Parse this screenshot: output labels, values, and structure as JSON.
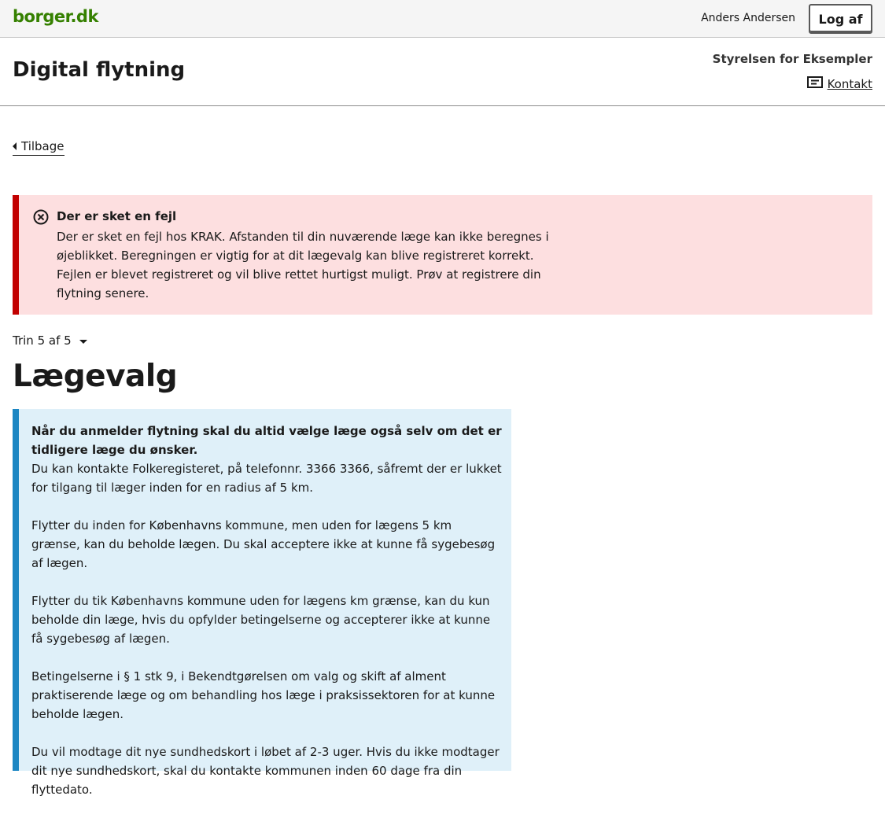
{
  "topbar": {
    "logo": "borger.dk",
    "username": "Anders Andersen",
    "logout_label": "Log af"
  },
  "header": {
    "title": "Digital flytning",
    "authority": "Styrelsen for Eksempler",
    "contact_label": "Kontakt"
  },
  "nav": {
    "back_label": "Tilbage"
  },
  "error": {
    "heading": "Der er sket en fejl",
    "text": "Der er sket en fejl hos KRAK. Afstanden til din nuværende læge kan ikke beregnes i øjeblikket. Beregningen er vigtig for at dit lægevalg kan blive registreret korrekt. Fejlen er blevet registreret og vil blive rettet hurtigst muligt. Prøv at registrere din flytning senere."
  },
  "step": {
    "label": "Trin 5 af 5"
  },
  "page": {
    "title": "Lægevalg"
  },
  "info": {
    "lead": "Når du anmelder flytning skal du altid vælge læge også selv om det er tidligere læge du ønsker.",
    "p1": "Du kan kontakte Folkeregisteret, på telefonnr. 3366 3366, såfremt der er lukket for tilgang til læger inden for en radius af 5 km.",
    "p2": "Flytter du inden for Københavns kommune, men uden for lægens 5 km grænse, kan du beholde lægen. Du skal acceptere ikke at kunne få sygebesøg af lægen.",
    "p3": "Flytter du tik Københavns kommune uden for lægens km grænse, kan du kun beholde din læge, hvis du opfylder betingelserne og accepterer ikke at kunne få sygebesøg af lægen.",
    "p4": "Betingelserne i § 1 stk 9, i Bekendtgørelsen om valg og skift af alment praktiserende læge og om behandling hos læge i praksissektoren for at kunne beholde lægen.",
    "p5": "Du vil modtage dit nye sundhedskort i løbet af 2-3 uger. Hvis du ikke modtager dit nye sundhedskort, skal du kontakte kommunen inden 60 dage fra din flyttedato."
  },
  "colors": {
    "brand_green": "#358000",
    "error_bg": "#fddfe0",
    "error_border": "#c20000",
    "info_bg": "#dff0f9",
    "info_border": "#1b86c3"
  },
  "icons": {
    "error": "close-circle-icon",
    "contact": "message-icon",
    "back": "caret-left-icon",
    "step": "caret-down-icon"
  }
}
